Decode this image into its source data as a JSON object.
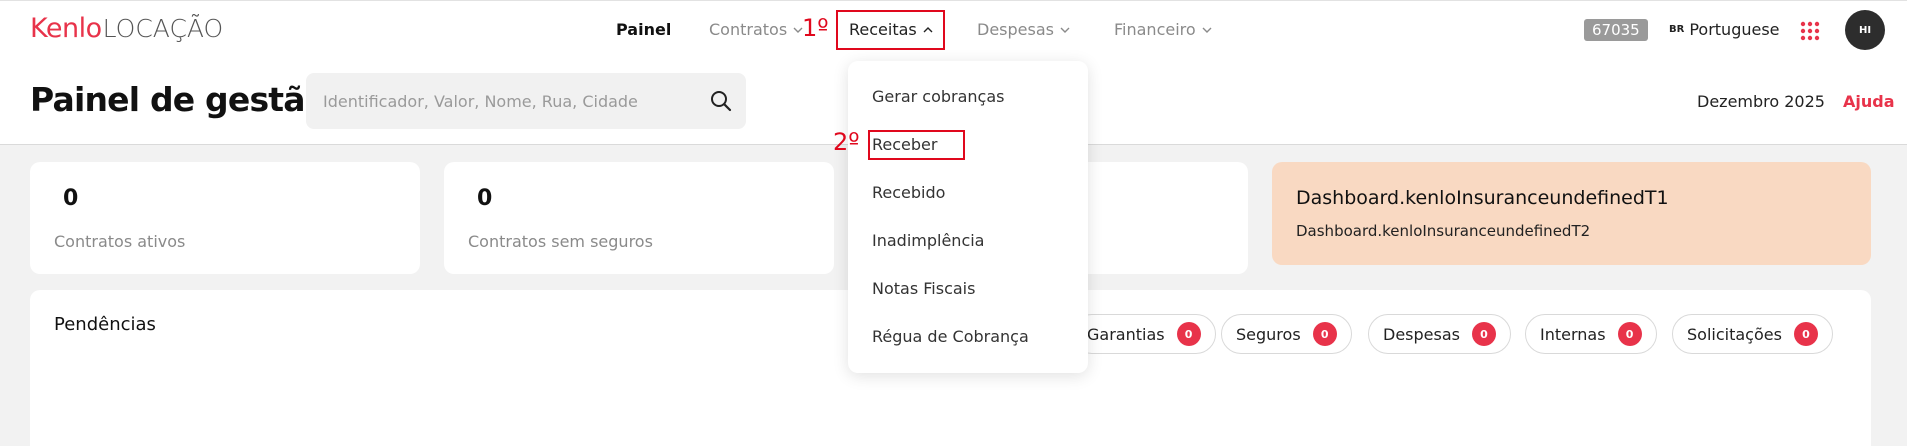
{
  "app": {
    "logo_brand": "Kenlo",
    "logo_sub": "LOCAÇÃO"
  },
  "nav": {
    "items": [
      {
        "label": "Painel"
      },
      {
        "label": "Contratos"
      },
      {
        "label": "Receitas"
      },
      {
        "label": "Despesas"
      },
      {
        "label": "Financeiro"
      }
    ],
    "active": "Painel"
  },
  "annotations": {
    "step1": "1º",
    "step2": "2º"
  },
  "account": {
    "counter": "67035",
    "lang_flag": "BR",
    "lang_label": "Portuguese",
    "avatar_initials": "HI"
  },
  "header": {
    "title": "Painel de gestão",
    "search_placeholder": "Identificador, Valor, Nome, Rua, Cidade",
    "date": "Dezembro 2025",
    "help": "Ajuda"
  },
  "cards": [
    {
      "value": "0",
      "label": "Contratos ativos"
    },
    {
      "value": "0",
      "label": "Contratos sem seguros"
    }
  ],
  "insurance": {
    "t1": "Dashboard.kenloInsuranceundefinedT1",
    "t2": "Dashboard.kenloInsuranceundefinedT2"
  },
  "pendencias": {
    "title": "Pendências",
    "filters": [
      {
        "label": "Garantias",
        "count": "0"
      },
      {
        "label": "Seguros",
        "count": "0"
      },
      {
        "label": "Despesas",
        "count": "0"
      },
      {
        "label": "Internas",
        "count": "0"
      },
      {
        "label": "Solicitações",
        "count": "0"
      }
    ]
  },
  "receitas_menu": {
    "items": [
      {
        "label": "Gerar cobranças"
      },
      {
        "label": "Receber"
      },
      {
        "label": "Recebido"
      },
      {
        "label": "Inadimplência"
      },
      {
        "label": "Notas Fiscais"
      },
      {
        "label": "Régua de Cobrança"
      }
    ]
  },
  "colors": {
    "brand": "#e8334a",
    "annotation": "#e0081d",
    "insurance_bg": "#f9d9c2"
  }
}
